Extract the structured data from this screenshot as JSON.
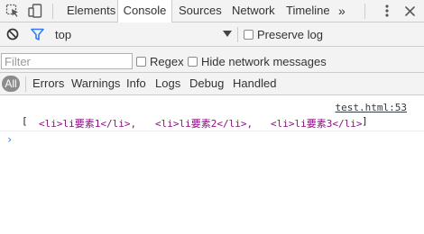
{
  "tabs": {
    "items": [
      {
        "label": "Elements"
      },
      {
        "label": "Console"
      },
      {
        "label": "Sources"
      },
      {
        "label": "Network"
      },
      {
        "label": "Timeline"
      }
    ],
    "overflow": "»",
    "active": "Console"
  },
  "context": {
    "value": "top",
    "preserve_log_label": "Preserve log"
  },
  "filter": {
    "placeholder": "Filter",
    "regex_label": "Regex",
    "hide_network_label": "Hide network messages"
  },
  "levels": {
    "all": "All",
    "items": [
      "Errors",
      "Warnings",
      "Info",
      "Logs",
      "Debug",
      "Handled"
    ]
  },
  "console": {
    "source": "test.html:53",
    "open_bracket": "[",
    "close_bracket": "]",
    "items": [
      "<li>li要素1</li>,",
      "<li>li要素2</li>,",
      "<li>li要素3</li>"
    ],
    "prompt": "›"
  },
  "colors": {
    "toolbar_bg": "#f3f3f3",
    "accent_blue": "#367cf1",
    "element_purple": "#881280"
  },
  "icons": [
    "inspect-element-icon",
    "device-toolbar-icon",
    "more-vertical-icon",
    "close-icon",
    "clear-console-icon",
    "filter-icon",
    "dropdown-arrow-icon"
  ]
}
